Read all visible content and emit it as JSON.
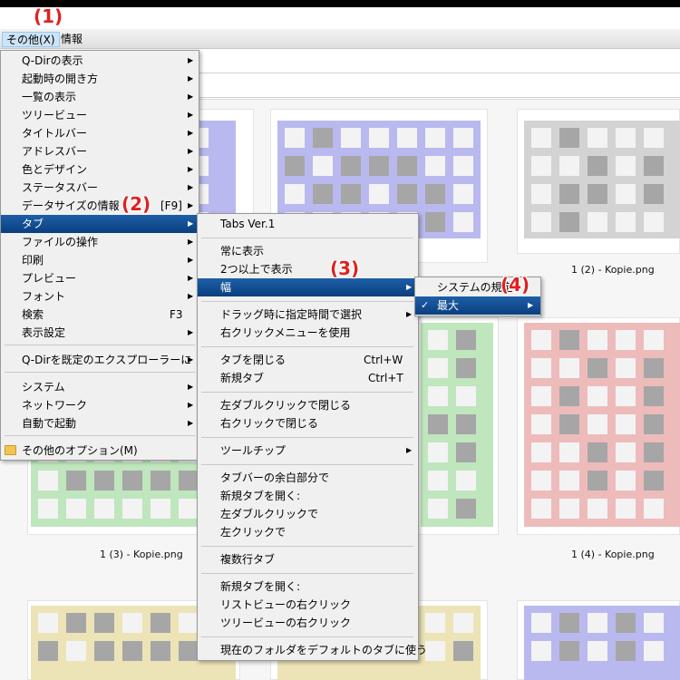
{
  "menubar": {
    "items": [
      {
        "label": "その他(X)"
      },
      {
        "label": "情報"
      }
    ]
  },
  "callouts": [
    "(1)",
    "(2)",
    "(3)",
    "(4)"
  ],
  "thumbnails": {
    "captions": [
      "1 (2) - Kopie.png",
      "1 (3) - Kopie.png",
      "1 (4) - Kopie.png"
    ],
    "colors": {
      "blue": "#b9b9ef",
      "gray": "#d3d3d3",
      "green": "#bfe6bd",
      "red": "#eebbbb",
      "yellow": "#ece4b6"
    }
  },
  "main_menu": {
    "items": [
      {
        "label": "Q-Dirの表示"
      },
      {
        "label": "起動時の開き方"
      },
      {
        "label": "一覧の表示"
      },
      {
        "label": "ツリービュー"
      },
      {
        "label": "タイトルバー"
      },
      {
        "label": "アドレスバー"
      },
      {
        "label": "色とデザイン"
      },
      {
        "label": "ステータスバー"
      },
      {
        "label": "データサイズの情報",
        "shortcut": "[F9]"
      },
      {
        "label": "タブ"
      },
      {
        "label": "ファイルの操作"
      },
      {
        "label": "印刷"
      },
      {
        "label": "プレビュー"
      },
      {
        "label": "フォント"
      },
      {
        "label": "検索",
        "shortcut": "F3"
      },
      {
        "label": "表示設定"
      },
      {
        "label": "Q-Dirを既定のエクスプローラーに"
      },
      {
        "label": "システム"
      },
      {
        "label": "ネットワーク"
      },
      {
        "label": "自動で起動"
      },
      {
        "label": "その他のオプション(M)"
      }
    ]
  },
  "tab_menu": {
    "items": [
      {
        "label": "Tabs Ver.1"
      },
      {
        "label": "常に表示"
      },
      {
        "label": "2つ以上で表示"
      },
      {
        "label": "幅"
      },
      {
        "label": "ドラッグ時に指定時間で選択"
      },
      {
        "label": "右クリックメニューを使用"
      },
      {
        "label": "タブを閉じる",
        "shortcut": "Ctrl+W"
      },
      {
        "label": "新規タブ",
        "shortcut": "Ctrl+T"
      },
      {
        "label": "左ダブルクリックで閉じる"
      },
      {
        "label": "右クリックで閉じる"
      },
      {
        "label": "ツールチップ"
      },
      {
        "label": "タブバーの余白部分で"
      },
      {
        "label": "新規タブを開く:"
      },
      {
        "label": "左ダブルクリックで"
      },
      {
        "label": "左クリックで"
      },
      {
        "label": "複数行タブ"
      },
      {
        "label": "新規タブを開く:"
      },
      {
        "label": "リストビューの右クリック"
      },
      {
        "label": "ツリービューの右クリック"
      },
      {
        "label": "現在のフォルダをデフォルトのタブに使う"
      }
    ]
  },
  "width_menu": {
    "items": [
      {
        "label": "システムの規定"
      },
      {
        "label": "最大"
      }
    ]
  }
}
